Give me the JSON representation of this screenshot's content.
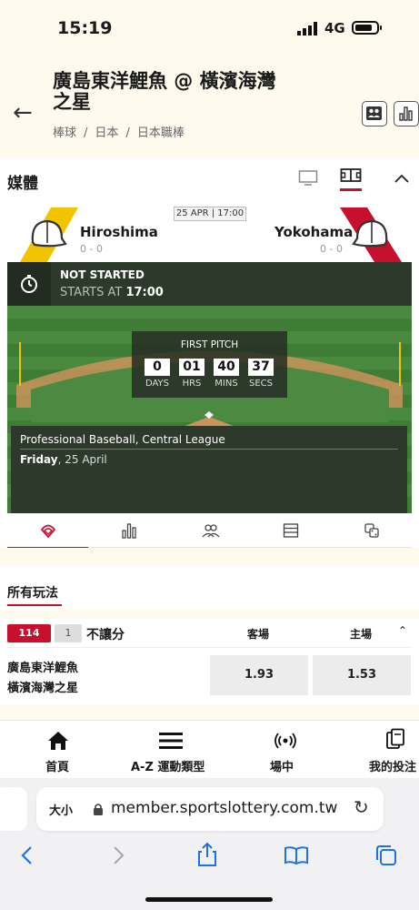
{
  "statusbar": {
    "time": "15:19",
    "network": "4G"
  },
  "header": {
    "title": "廣島東洋鯉魚 @ 橫濱海灣之星",
    "breadcrumbs": [
      "棒球",
      "日本",
      "日本職棒"
    ]
  },
  "media": {
    "label": "媒體"
  },
  "match": {
    "date": "25 APR | 17:00",
    "home": {
      "name": "Hiroshima",
      "score": "0 - 0",
      "color": "#f2c400"
    },
    "away": {
      "name": "Yokohama",
      "score": "0 - 0",
      "color": "#c8102e"
    },
    "status": "NOT STARTED",
    "starts_prefix": "STARTS AT",
    "starts_time": "17:00",
    "countdown": {
      "title": "FIRST PITCH",
      "days": "0",
      "hrs": "01",
      "mins": "40",
      "secs": "37",
      "days_label": "DAYS",
      "hrs_label": "HRS",
      "mins_label": "MINS",
      "secs_label": "SECS"
    },
    "league": "Professional Baseball, Central League",
    "day": "Friday",
    "date_text": ", 25 April"
  },
  "tabs": [
    "baseball-icon",
    "stats-icon",
    "lineups-icon",
    "standings-icon",
    "odds-icon"
  ],
  "section": {
    "title": "所有玩法"
  },
  "market": {
    "count": "114",
    "sub_count": "1",
    "name": "不讓分",
    "col_away": "客場",
    "col_home": "主場",
    "team1": "廣島東洋鯉魚",
    "team2": "橫濱海灣之星",
    "odd_away": "1.93",
    "odd_home": "1.53"
  },
  "bottom_nav": [
    {
      "label": "首頁",
      "icon": "home-icon"
    },
    {
      "label": "A-Z 運動類型",
      "icon": "menu-icon"
    },
    {
      "label": "場中",
      "icon": "live-icon"
    },
    {
      "label": "我的投注",
      "icon": "bets-icon"
    }
  ],
  "browser": {
    "text_size": "大小",
    "url": "member.sportslottery.com.tw"
  },
  "colors": {
    "accent": "#c8102e",
    "cream": "#fffaee",
    "field": "#3d7a34"
  }
}
